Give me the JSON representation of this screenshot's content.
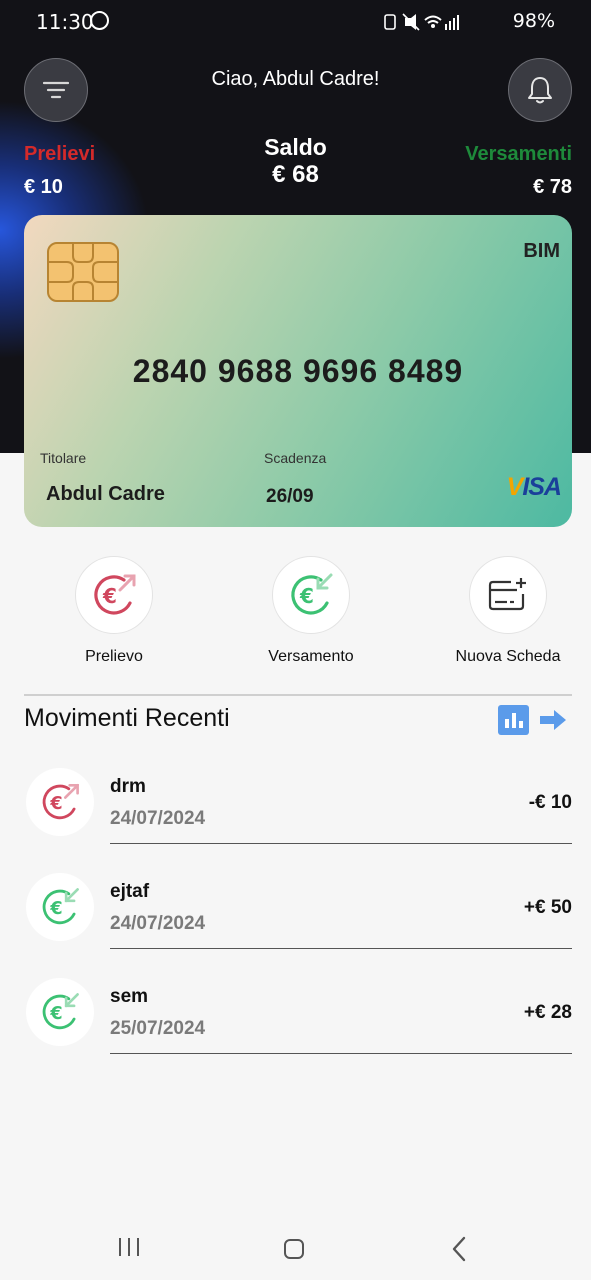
{
  "status_bar": {
    "time": "11:30",
    "battery": "98%"
  },
  "header": {
    "greeting": "Ciao, Abdul Cadre!",
    "prelievi_label": "Prelievi",
    "prelievi_value": "€ 10",
    "saldo_label": "Saldo",
    "saldo_value": "€ 68",
    "versamenti_label": "Versamenti",
    "versamenti_value": "€ 78"
  },
  "card": {
    "brand": "BIM",
    "number": "2840 9688 9696 8489",
    "holder_label": "Titolare",
    "holder_name": "Abdul Cadre",
    "expiry_label": "Scadenza",
    "expiry": "26/09",
    "network": "VISA"
  },
  "actions": [
    {
      "label": "Prelievo",
      "icon": "euro-withdraw-icon"
    },
    {
      "label": "Versamento",
      "icon": "euro-deposit-icon"
    },
    {
      "label": "Nuova Scheda",
      "icon": "add-card-icon"
    }
  ],
  "movements": {
    "title": "Movimenti Recenti",
    "items": [
      {
        "name": "drm",
        "date": "24/07/2024",
        "amount": "-€ 10",
        "type": "withdraw"
      },
      {
        "name": "ejtaf",
        "date": "24/07/2024",
        "amount": "+€ 50",
        "type": "deposit"
      },
      {
        "name": "sem",
        "date": "25/07/2024",
        "amount": "+€ 28",
        "type": "deposit"
      }
    ]
  },
  "colors": {
    "withdraw": "#d0475e",
    "deposit": "#3cc173",
    "prelievi_text": "#d42a2a",
    "versamenti_text": "#1e8a3b",
    "accent": "#5b9bea"
  }
}
